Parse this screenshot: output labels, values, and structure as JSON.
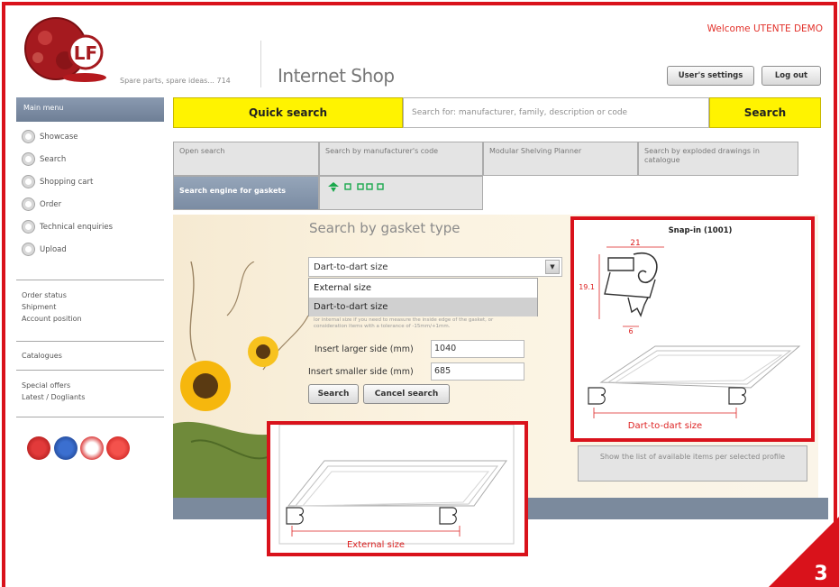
{
  "header": {
    "tagline": "Spare parts, spare ideas... 714",
    "shop_title": "Internet Shop",
    "welcome": "Welcome UTENTE DEMO",
    "user_settings": "User's settings",
    "logout": "Log out"
  },
  "sidebar": {
    "title": "Main menu",
    "items": [
      {
        "label": "Showcase"
      },
      {
        "label": "Search"
      },
      {
        "label": "Shopping cart"
      },
      {
        "label": "Order"
      },
      {
        "label": "Technical enquiries"
      },
      {
        "label": "Upload"
      }
    ],
    "links": [
      "Order status",
      "Shipment",
      "Account position",
      "Catalogues",
      "Special offers",
      "Latest / Dogliants"
    ]
  },
  "quick_search": {
    "label": "Quick search",
    "placeholder": "Search for: manufacturer, family, description or code",
    "button": "Search"
  },
  "tabs": [
    {
      "label": "Open search"
    },
    {
      "label": "Search by manufacturer's code"
    },
    {
      "label": "Modular Shelving Planner"
    },
    {
      "label": "Search by exploded drawings in catalogue"
    },
    {
      "label": "Search engine for gaskets"
    }
  ],
  "gasket_search": {
    "title": "Search by gasket type",
    "size_select": "Dart-to-dart size",
    "options": [
      "External size",
      "Dart-to-dart size"
    ],
    "note_line1": "lor internal size if you need to measure the inside edge of the gasket, or",
    "note_line2": "consideration items with a tolerance of -15mm/+1mm.",
    "larger_label": "Insert larger side (mm)",
    "larger_value": "1040",
    "smaller_label": "Insert smaller side (mm)",
    "smaller_value": "685",
    "search_button": "Search",
    "cancel_button": "Cancel search"
  },
  "profile": {
    "title": "Snap-in (1001)",
    "width": "21",
    "height": "19.1",
    "lip": "6",
    "caption": "Dart-to-dart size",
    "list_button": "Show the list of available items per selected profile"
  },
  "callout": {
    "caption": "External size"
  },
  "step_number": "3",
  "colors": {
    "accent_red": "#d9121b",
    "quick_search_yellow": "#fff300",
    "menu_blue": "#7b8ca3"
  }
}
